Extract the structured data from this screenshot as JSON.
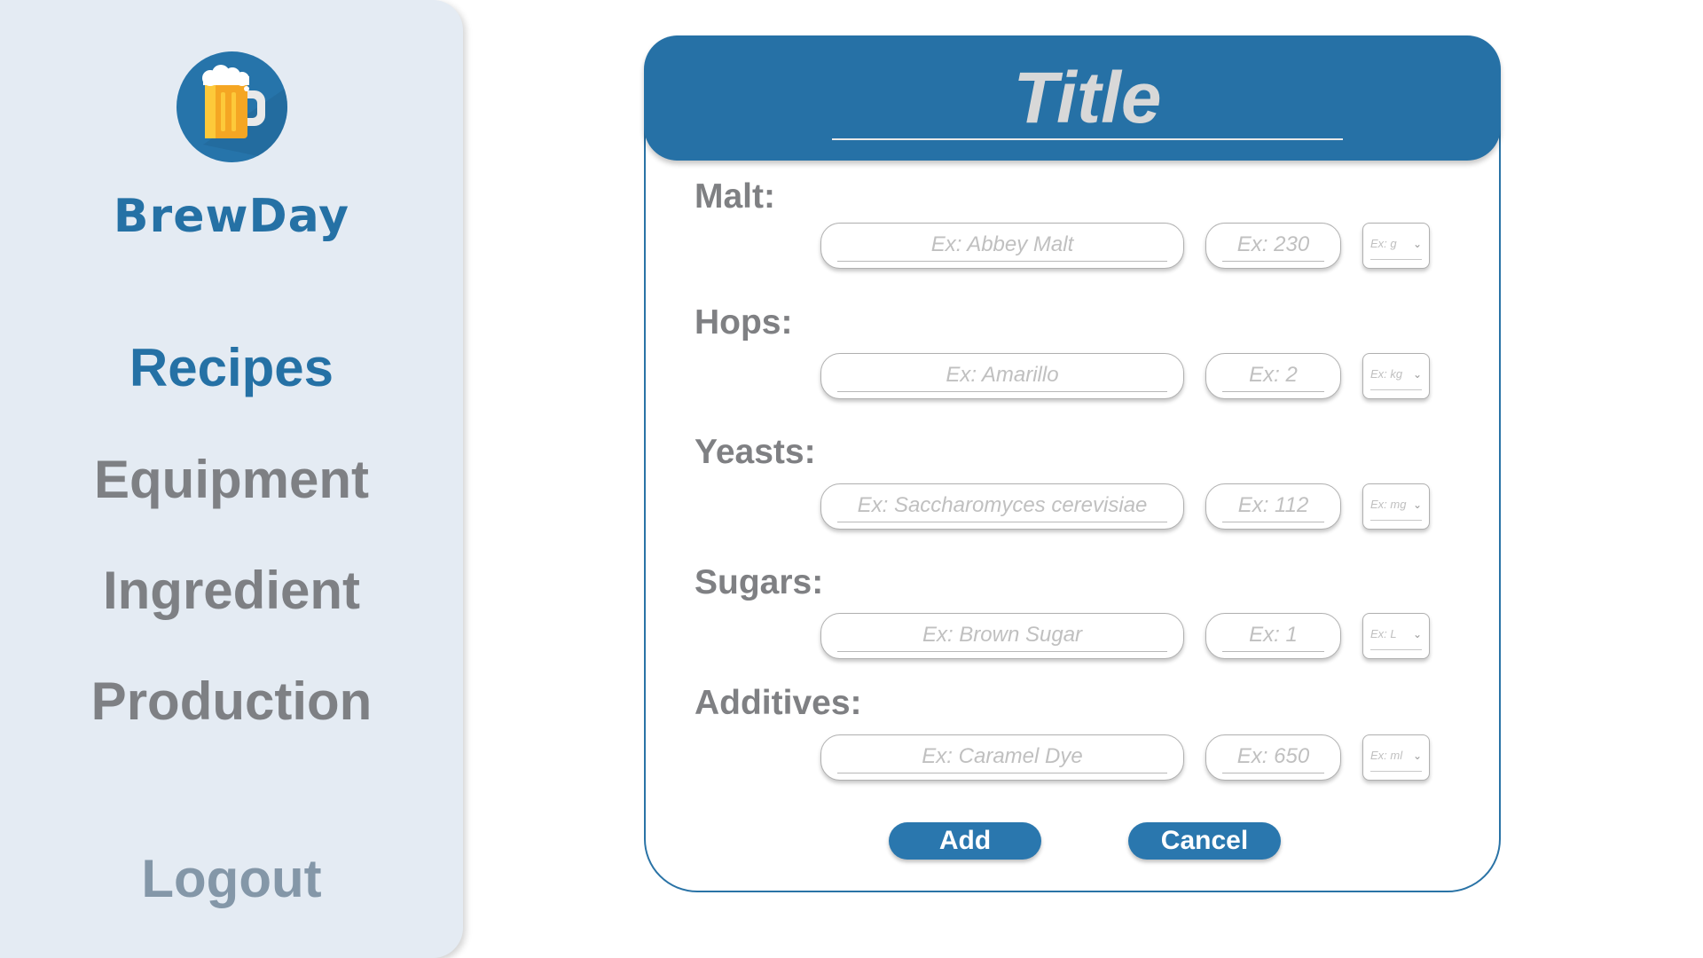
{
  "app": {
    "name": "BrewDay",
    "logo_icon": "beer-mug-icon",
    "accent_color": "#2571a5"
  },
  "sidebar": {
    "items": [
      {
        "label": "Recipes",
        "active": true
      },
      {
        "label": "Equipment",
        "active": false
      },
      {
        "label": "Ingredient",
        "active": false
      },
      {
        "label": "Production",
        "active": false
      }
    ],
    "logout_label": "Logout"
  },
  "form": {
    "title_placeholder": "Title",
    "sections": [
      {
        "label": "Malt:",
        "name_placeholder": "Ex: Abbey Malt",
        "amount_placeholder": "Ex: 230",
        "unit_placeholder": "Ex: g"
      },
      {
        "label": "Hops:",
        "name_placeholder": "Ex: Amarillo",
        "amount_placeholder": "Ex: 2",
        "unit_placeholder": "Ex: kg"
      },
      {
        "label": "Yeasts:",
        "name_placeholder": "Ex: Saccharomyces cerevisiae",
        "amount_placeholder": "Ex: 112",
        "unit_placeholder": "Ex: mg"
      },
      {
        "label": "Sugars:",
        "name_placeholder": "Ex: Brown Sugar",
        "amount_placeholder": "Ex: 1",
        "unit_placeholder": "Ex: L"
      },
      {
        "label": "Additives:",
        "name_placeholder": "Ex: Caramel Dye",
        "amount_placeholder": "Ex: 650",
        "unit_placeholder": "Ex: ml"
      }
    ],
    "add_label": "Add",
    "cancel_label": "Cancel"
  }
}
